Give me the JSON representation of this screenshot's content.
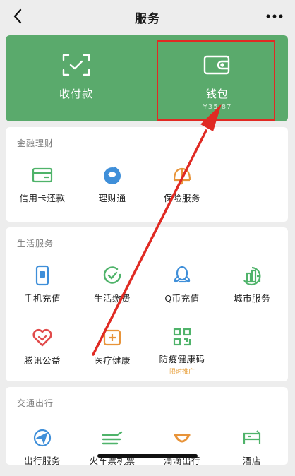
{
  "nav": {
    "title": "服务",
    "back_icon": "chevron-left-icon",
    "more_icon": "more-dots-icon"
  },
  "pay": {
    "collect": {
      "label": "收付款",
      "icon": "scan-code-icon"
    },
    "wallet": {
      "label": "钱包",
      "balance": "¥35.87",
      "icon": "wallet-icon"
    }
  },
  "finance": {
    "title": "金融理财",
    "items": [
      {
        "label": "信用卡还款",
        "icon": "credit-card-icon"
      },
      {
        "label": "理财通",
        "icon": "wealth-icon"
      },
      {
        "label": "保险服务",
        "icon": "insurance-icon"
      }
    ]
  },
  "life": {
    "title": "生活服务",
    "items": [
      {
        "label": "手机充值",
        "icon": "phone-topup-icon"
      },
      {
        "label": "生活缴费",
        "icon": "utility-bill-icon"
      },
      {
        "label": "Q币充值",
        "icon": "qq-coin-icon"
      },
      {
        "label": "城市服务",
        "icon": "city-service-icon"
      },
      {
        "label": "腾讯公益",
        "icon": "charity-heart-icon"
      },
      {
        "label": "医疗健康",
        "icon": "medical-icon"
      },
      {
        "label": "防疫健康码",
        "icon": "qr-code-icon",
        "tag": "限时推广"
      }
    ]
  },
  "transport": {
    "title": "交通出行",
    "items": [
      {
        "label": "出行服务",
        "icon": "navigation-icon"
      },
      {
        "label": "火车票机票",
        "icon": "train-ticket-icon"
      },
      {
        "label": "滴滴出行",
        "icon": "didi-icon"
      },
      {
        "label": "酒店",
        "icon": "hotel-icon"
      }
    ]
  },
  "colors": {
    "brand_green": "#5aaa6c",
    "icon_green": "#4fb36a",
    "icon_blue": "#3f8fd9",
    "icon_orange": "#e8943a",
    "icon_red": "#e14b4b",
    "annotation_red": "#e02a23"
  }
}
